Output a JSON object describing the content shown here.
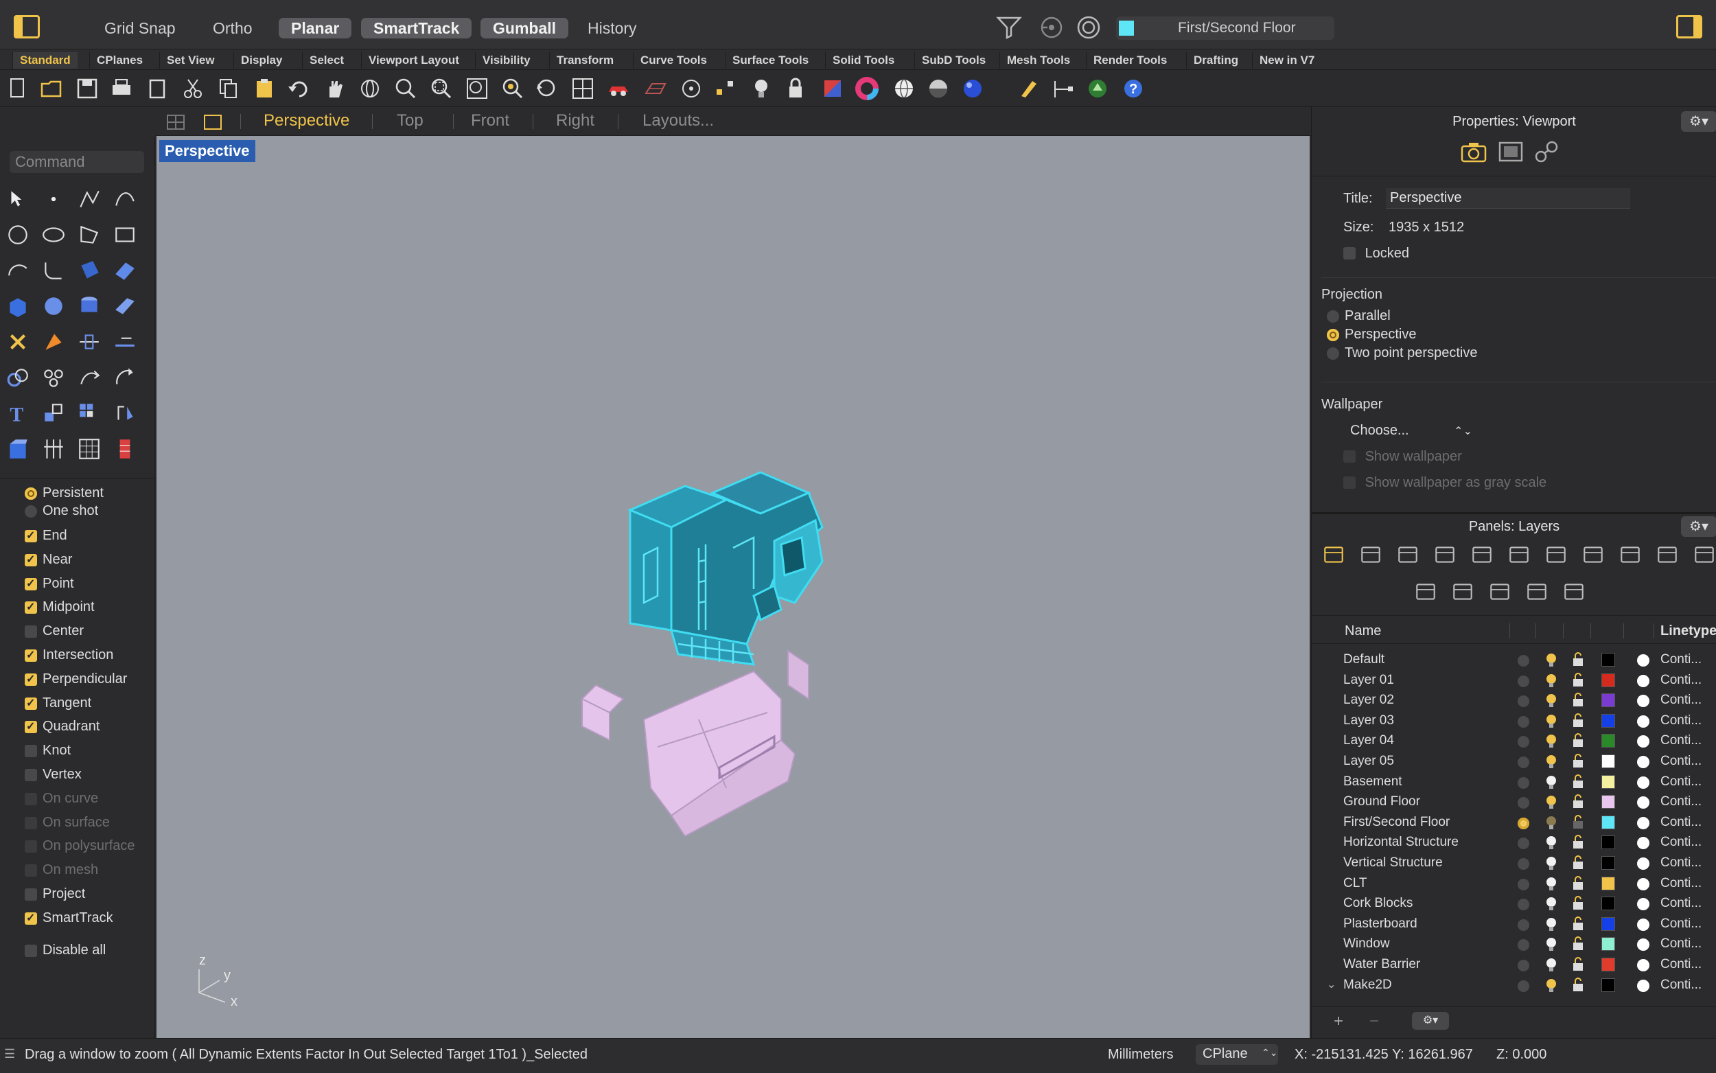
{
  "titlebar": {
    "modes": [
      {
        "label": "Grid Snap",
        "on": false
      },
      {
        "label": "Ortho",
        "on": false
      },
      {
        "label": "Planar",
        "on": true
      },
      {
        "label": "SmartTrack",
        "on": true
      },
      {
        "label": "Gumball",
        "on": true
      },
      {
        "label": "History",
        "on": false
      }
    ],
    "current_layer": "First/Second Floor",
    "current_layer_color": "#5ee6f6"
  },
  "tabs": [
    "Standard",
    "CPlanes",
    "Set View",
    "Display",
    "Select",
    "Viewport Layout",
    "Visibility",
    "Transform",
    "Curve Tools",
    "Surface Tools",
    "Solid Tools",
    "SubD Tools",
    "Mesh Tools",
    "Render Tools",
    "Drafting",
    "New in V7"
  ],
  "active_tab": "Standard",
  "command": {
    "placeholder": "Command"
  },
  "osnap": {
    "mode_persistent": "Persistent",
    "mode_oneshot": "One shot",
    "items": [
      {
        "label": "End",
        "checked": true,
        "enabled": true
      },
      {
        "label": "Near",
        "checked": true,
        "enabled": true
      },
      {
        "label": "Point",
        "checked": true,
        "enabled": true
      },
      {
        "label": "Midpoint",
        "checked": true,
        "enabled": true
      },
      {
        "label": "Center",
        "checked": false,
        "enabled": true
      },
      {
        "label": "Intersection",
        "checked": true,
        "enabled": true
      },
      {
        "label": "Perpendicular",
        "checked": true,
        "enabled": true
      },
      {
        "label": "Tangent",
        "checked": true,
        "enabled": true
      },
      {
        "label": "Quadrant",
        "checked": true,
        "enabled": true
      },
      {
        "label": "Knot",
        "checked": false,
        "enabled": true
      },
      {
        "label": "Vertex",
        "checked": false,
        "enabled": true
      },
      {
        "label": "On curve",
        "checked": false,
        "enabled": false
      },
      {
        "label": "On surface",
        "checked": false,
        "enabled": false
      },
      {
        "label": "On polysurface",
        "checked": false,
        "enabled": false
      },
      {
        "label": "On mesh",
        "checked": false,
        "enabled": false
      },
      {
        "label": "Project",
        "checked": false,
        "enabled": true
      },
      {
        "label": "SmartTrack",
        "checked": true,
        "enabled": true
      }
    ],
    "disable_all": "Disable all"
  },
  "viewport_tabs": [
    "Perspective",
    "Top",
    "Front",
    "Right",
    "Layouts..."
  ],
  "active_viewport": "Perspective",
  "viewport": {
    "label": "Perspective",
    "axes": {
      "z": "z",
      "y": "y",
      "x": "x"
    }
  },
  "properties": {
    "title": "Properties: Viewport",
    "title_label": "Title:",
    "title_value": "Perspective",
    "size_label": "Size:",
    "size_value": "1935 x 1512",
    "locked_label": "Locked",
    "projection_heading": "Projection",
    "projection_options": [
      "Parallel",
      "Perspective",
      "Two point perspective"
    ],
    "projection_selected": "Perspective",
    "wallpaper_heading": "Wallpaper",
    "wallpaper_choose": "Choose...",
    "show_wallpaper": "Show wallpaper",
    "show_gray": "Show wallpaper as gray scale"
  },
  "layers_panel": {
    "title": "Panels: Layers",
    "col_name": "Name",
    "col_linetype": "Linetype",
    "layers": [
      {
        "name": "Default",
        "color": "#000000",
        "lt": "Conti...",
        "bulb_on": true,
        "current": false
      },
      {
        "name": "Layer 01",
        "color": "#d42b1e",
        "lt": "Conti...",
        "bulb_on": true,
        "current": false
      },
      {
        "name": "Layer 02",
        "color": "#7a3cd0",
        "lt": "Conti...",
        "bulb_on": true,
        "current": false
      },
      {
        "name": "Layer 03",
        "color": "#1440e6",
        "lt": "Conti...",
        "bulb_on": true,
        "current": false
      },
      {
        "name": "Layer 04",
        "color": "#2a8a2a",
        "lt": "Conti...",
        "bulb_on": true,
        "current": false
      },
      {
        "name": "Layer 05",
        "color": "#ffffff",
        "lt": "Conti...",
        "bulb_on": true,
        "current": false
      },
      {
        "name": "Basement",
        "color": "#f4f2a0",
        "lt": "Conti...",
        "bulb_on": false,
        "current": false
      },
      {
        "name": "Ground Floor",
        "color": "#e8c6ee",
        "lt": "Conti...",
        "bulb_on": true,
        "current": false
      },
      {
        "name": "First/Second Floor",
        "color": "#5ee6f6",
        "lt": "Conti...",
        "bulb_on": true,
        "current": true
      },
      {
        "name": "Horizontal Structure",
        "color": "#000000",
        "lt": "Conti...",
        "bulb_on": false,
        "current": false
      },
      {
        "name": "Vertical Structure",
        "color": "#000000",
        "lt": "Conti...",
        "bulb_on": false,
        "current": false
      },
      {
        "name": "CLT",
        "color": "#f0c34a",
        "lt": "Conti...",
        "bulb_on": false,
        "current": false
      },
      {
        "name": "Cork Blocks",
        "color": "#000000",
        "lt": "Conti...",
        "bulb_on": false,
        "current": false
      },
      {
        "name": "Plasterboard",
        "color": "#1440e6",
        "lt": "Conti...",
        "bulb_on": false,
        "current": false
      },
      {
        "name": "Window",
        "color": "#8ef0d0",
        "lt": "Conti...",
        "bulb_on": false,
        "current": false
      },
      {
        "name": "Water Barrier",
        "color": "#e03c2c",
        "lt": "Conti...",
        "bulb_on": false,
        "current": false
      },
      {
        "name": "Make2D",
        "color": "#000000",
        "lt": "Conti...",
        "bulb_on": true,
        "current": false,
        "expanded": true
      }
    ],
    "add_label": "+",
    "remove_label": "−"
  },
  "status": {
    "prompt": "Drag a window to zoom ( All Dynamic Extents Factor In Out Selected Target 1To1 )_Selected",
    "units": "Millimeters",
    "cplane": "CPlane",
    "coords": "X: -215131.425  Y: 16261.967",
    "z": "Z: 0.000"
  }
}
